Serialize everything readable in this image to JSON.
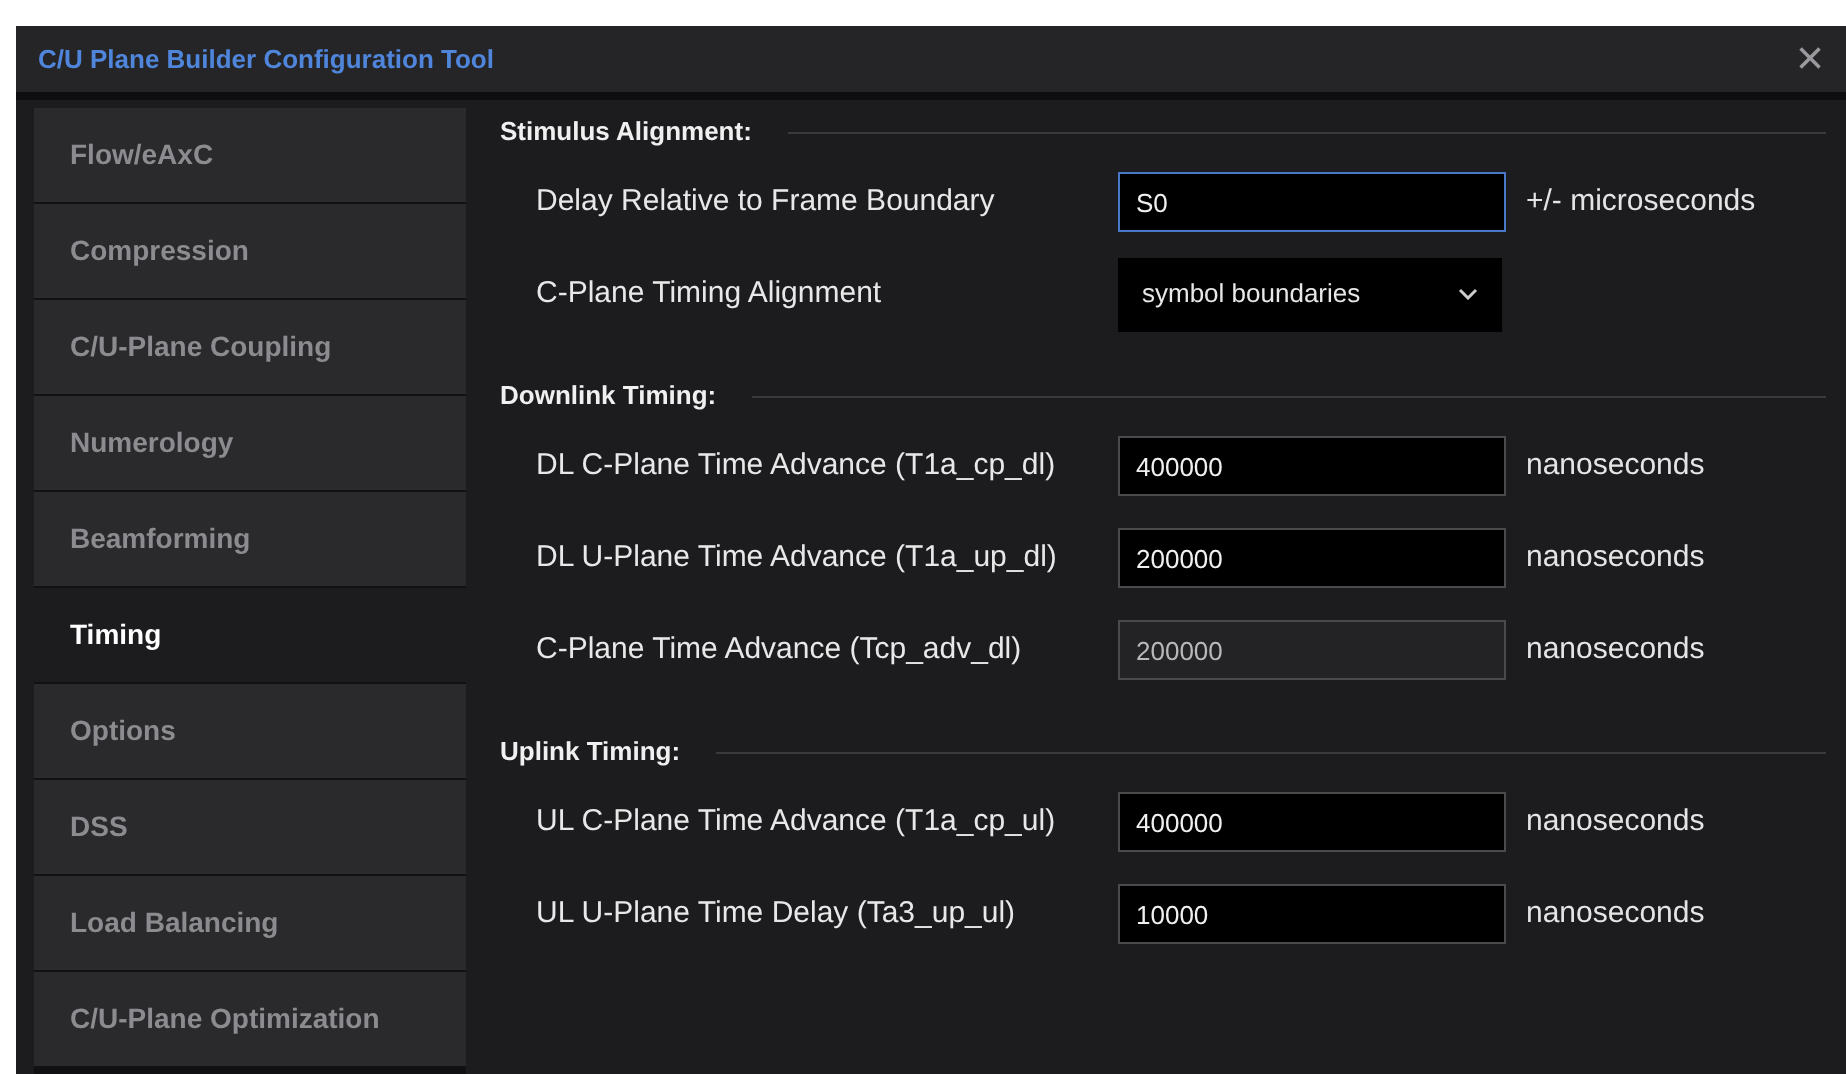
{
  "window": {
    "title": "C/U Plane Builder Configuration Tool",
    "close": "×"
  },
  "sidebar": {
    "items": [
      {
        "label": "Flow/eAxC",
        "selected": false
      },
      {
        "label": "Compression",
        "selected": false
      },
      {
        "label": "C/U-Plane Coupling",
        "selected": false
      },
      {
        "label": "Numerology",
        "selected": false
      },
      {
        "label": "Beamforming",
        "selected": false
      },
      {
        "label": "Timing",
        "selected": true
      },
      {
        "label": "Options",
        "selected": false
      },
      {
        "label": "DSS",
        "selected": false
      },
      {
        "label": "Load Balancing",
        "selected": false
      },
      {
        "label": "C/U-Plane Optimization",
        "selected": false
      }
    ]
  },
  "sections": [
    {
      "heading": "Stimulus Alignment:",
      "rows": [
        {
          "kind": "input",
          "label": "Delay Relative to Frame Boundary",
          "value": "S0",
          "unit": "+/- microseconds",
          "focused": true,
          "disabled": false
        },
        {
          "kind": "select",
          "label": "C-Plane Timing Alignment",
          "value": "symbol boundaries"
        }
      ]
    },
    {
      "heading": "Downlink Timing:",
      "rows": [
        {
          "kind": "input",
          "label": "DL C-Plane Time Advance (T1a_cp_dl)",
          "value": "400000",
          "unit": "nanoseconds",
          "focused": false,
          "disabled": false
        },
        {
          "kind": "input",
          "label": "DL U-Plane Time Advance (T1a_up_dl)",
          "value": "200000",
          "unit": "nanoseconds",
          "focused": false,
          "disabled": false
        },
        {
          "kind": "input",
          "label": "C-Plane Time Advance (Tcp_adv_dl)",
          "value": "200000",
          "unit": "nanoseconds",
          "focused": false,
          "disabled": true
        }
      ]
    },
    {
      "heading": "Uplink Timing:",
      "rows": [
        {
          "kind": "input",
          "label": "UL C-Plane Time Advance (T1a_cp_ul)",
          "value": "400000",
          "unit": "nanoseconds",
          "focused": false,
          "disabled": false
        },
        {
          "kind": "input",
          "label": "UL U-Plane Time Delay (Ta3_up_ul)",
          "value": "10000",
          "unit": "nanoseconds",
          "focused": false,
          "disabled": false
        }
      ]
    }
  ]
}
